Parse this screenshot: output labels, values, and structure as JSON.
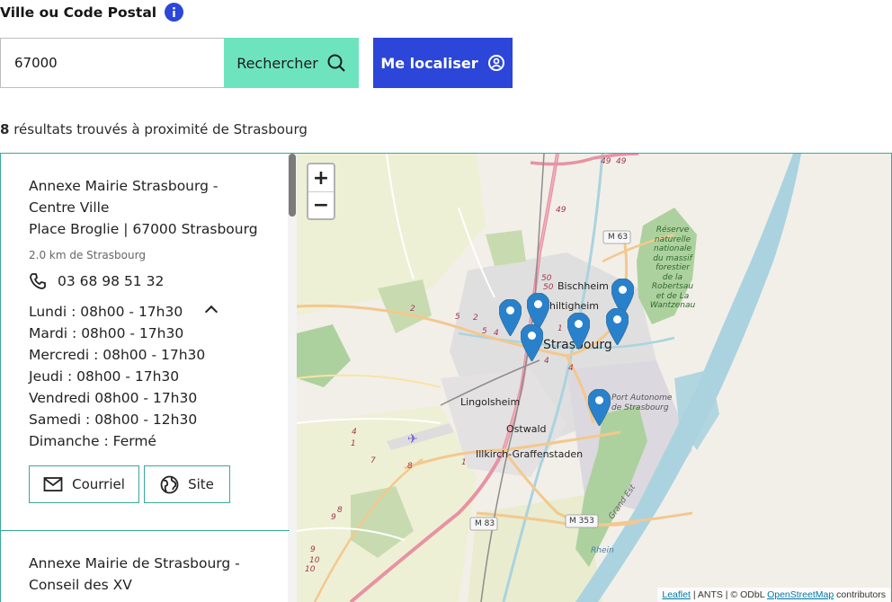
{
  "search": {
    "field_label": "Ville ou Code Postal",
    "input_value": "67000",
    "search_button": "Rechercher",
    "locate_button": "Me localiser"
  },
  "results": {
    "count": "8",
    "summary": "résultats trouvés à proximité de Strasbourg"
  },
  "card1": {
    "title_line1": "Annexe Mairie Strasbourg -",
    "title_line2": "Centre Ville",
    "address": "Place Broglie  | 67000 Strasbourg",
    "distance": "2.0 km de Strasbourg",
    "phone": "03 68 98 51 32",
    "hours": [
      "Lundi : 08h00 - 17h30",
      "Mardi : 08h00 - 17h30",
      "Mercredi : 08h00 - 17h30",
      "Jeudi : 08h00 - 17h30",
      "Vendredi 08h00 - 17h30",
      "Samedi : 08h00 - 12h30",
      "Dimanche : Fermé"
    ],
    "mail_button": "Courriel",
    "site_button": "Site"
  },
  "card2": {
    "title_line1": "Annexe Mairie de Strasbourg -",
    "title_line2": "Conseil des XV"
  },
  "map": {
    "zoom_in": "+",
    "zoom_out": "−",
    "labels": {
      "bischheim": "Bischheim",
      "schiltigheim": "Schiltigheim",
      "strasbourg": "Strasbourg",
      "lingolsheim": "Lingolsheim",
      "ostwald": "Ostwald",
      "illkirch": "Illkirch-Graffenstaden",
      "reserve": [
        "Réserve",
        "naturelle",
        "nationale",
        "du massif",
        "forestier",
        "de la Robertsau",
        "et de La",
        "Wantzenau"
      ],
      "port": [
        "Port Autonome",
        "de Strasbourg"
      ],
      "grand_est": "Grand Est",
      "rhein": "Rhein",
      "m63": "M 63",
      "m83": "M 83",
      "m353": "M 353",
      "road_numbers": [
        "49",
        "49",
        "49",
        "50",
        "50",
        "2",
        "2",
        "5",
        "5",
        "4",
        "4",
        "1",
        "1",
        "1",
        "7",
        "8",
        "8",
        "9",
        "9",
        "10",
        "10",
        "4",
        "4"
      ]
    },
    "attribution": {
      "leaflet": "Leaflet",
      "ants": " | ANTS | © ODbL ",
      "osm": "OpenStreetMap",
      "contrib": " contributors"
    },
    "colors": {
      "marker": "#2a81cb",
      "water": "#aad3df",
      "forest": "#add19e",
      "accent_green": "#6ee4be",
      "accent_blue": "#2b46d8",
      "border": "#39a89b"
    }
  }
}
